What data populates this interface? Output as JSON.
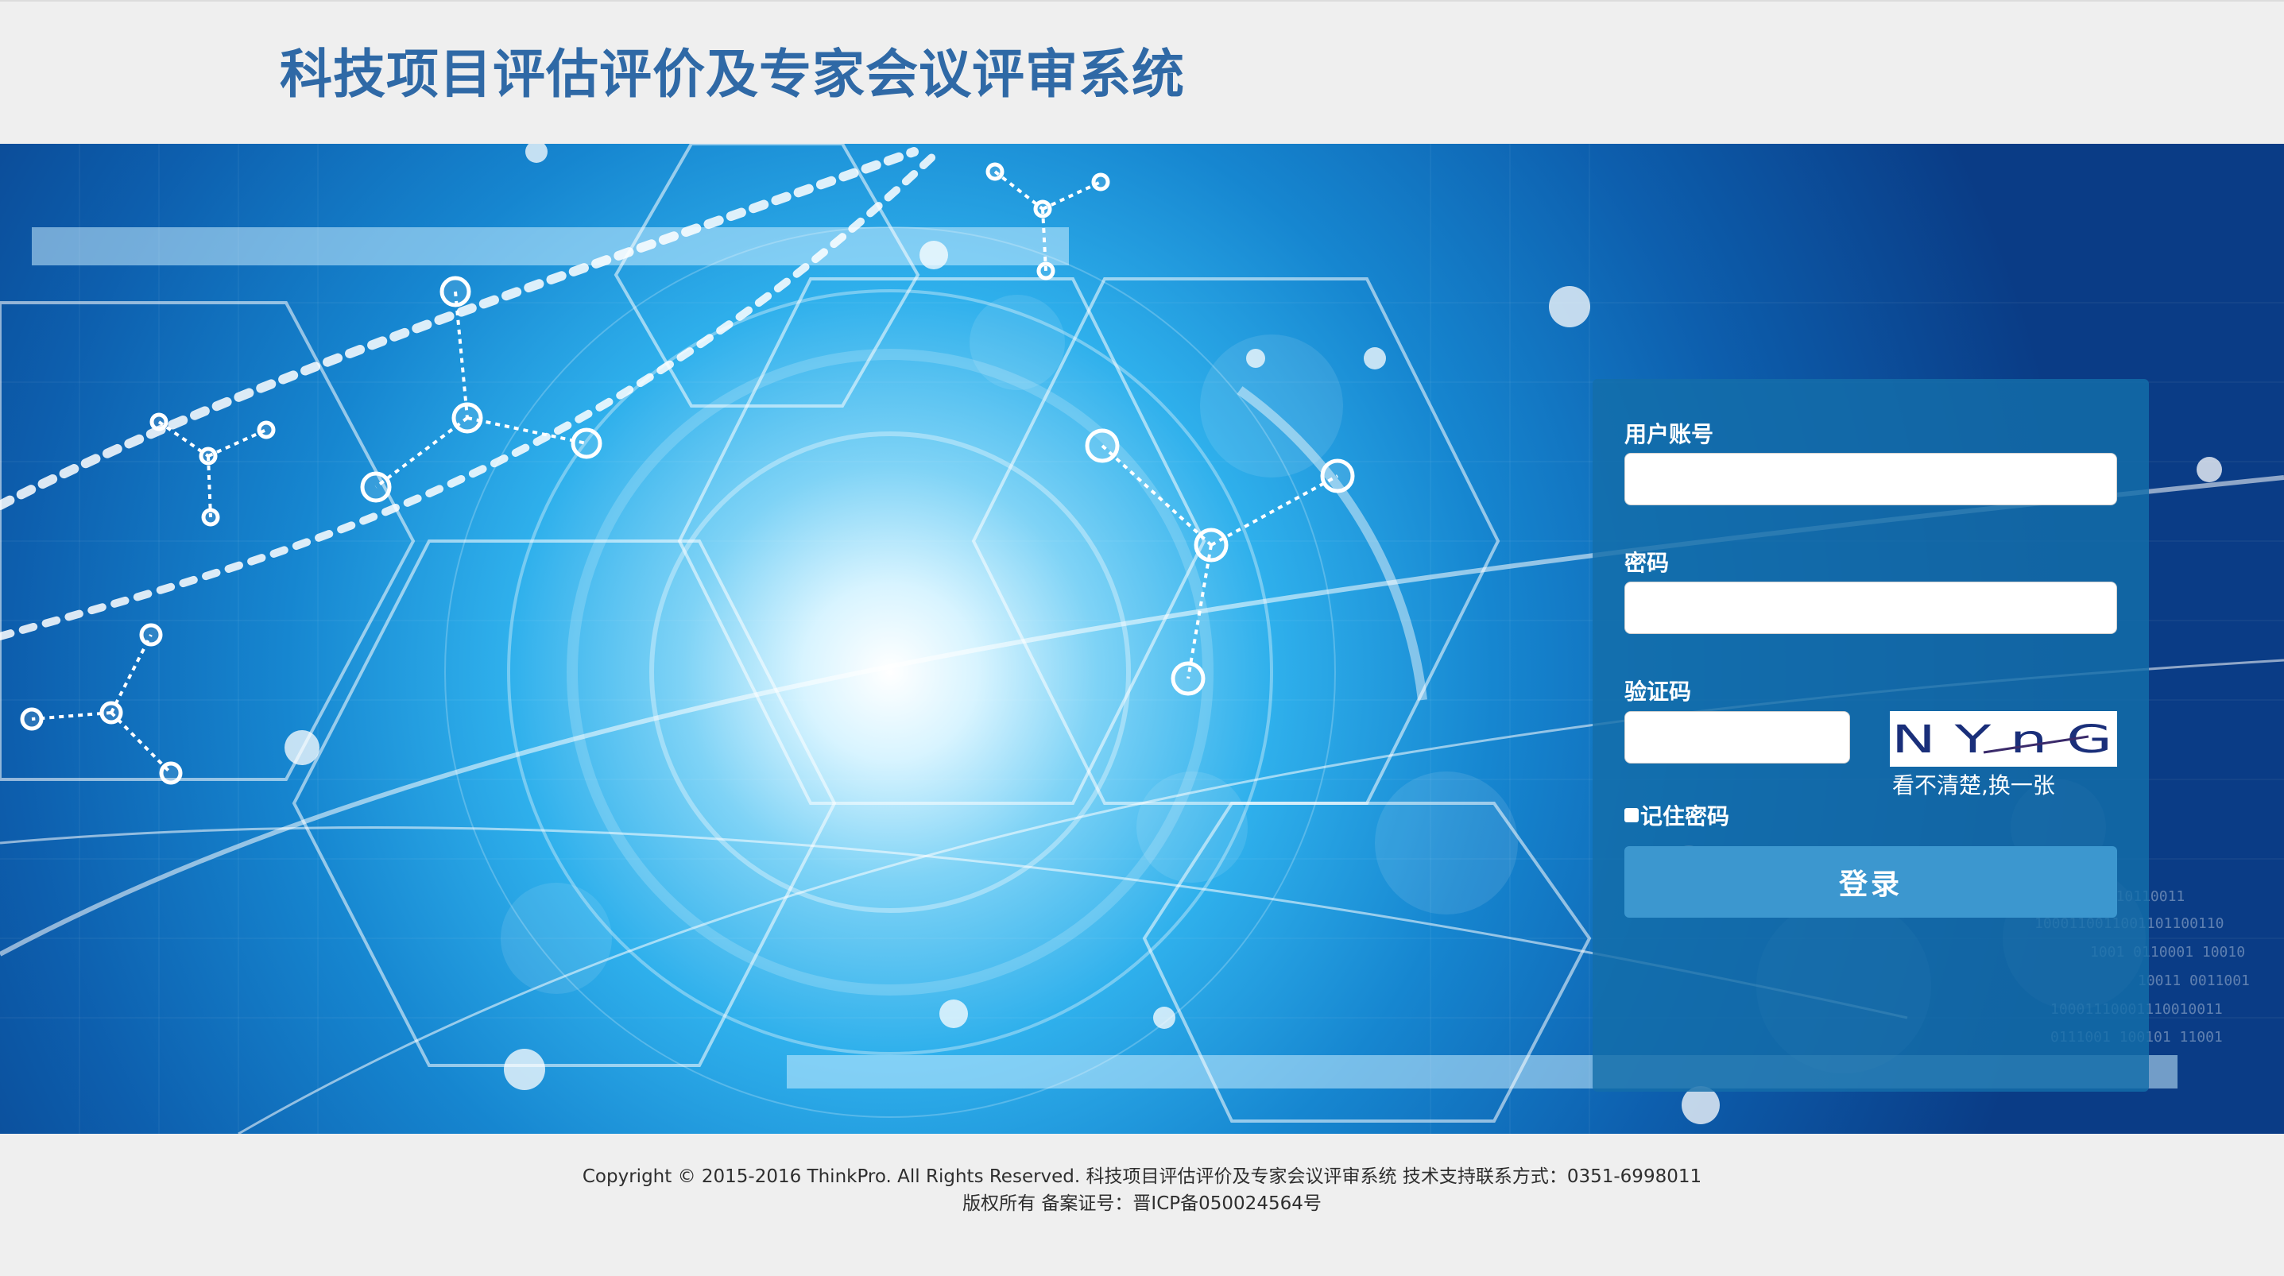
{
  "header": {
    "title": "科技项目评估评价及专家会议评审系统"
  },
  "login": {
    "username_label": "用户账号",
    "username_value": "",
    "password_label": "密码",
    "password_value": "",
    "captcha_label": "验证码",
    "captcha_value": "",
    "captcha_image_text": "N Y n G",
    "captcha_refresh": "看不清楚,换一张",
    "remember_label": "记住密码",
    "remember_checked": false,
    "submit_label": "登录"
  },
  "footer": {
    "line1": "Copyright © 2015-2016 ThinkPro. All Rights Reserved.   科技项目评估评价及专家会议评审系统 技术支持联系方式：0351-6998011",
    "line2": "版权所有 备案证号：晋ICP备050024564号"
  },
  "colors": {
    "title": "#2f69a6",
    "panel": "#146eaa",
    "button": "#3c97cf",
    "page_bg": "#efefef"
  }
}
